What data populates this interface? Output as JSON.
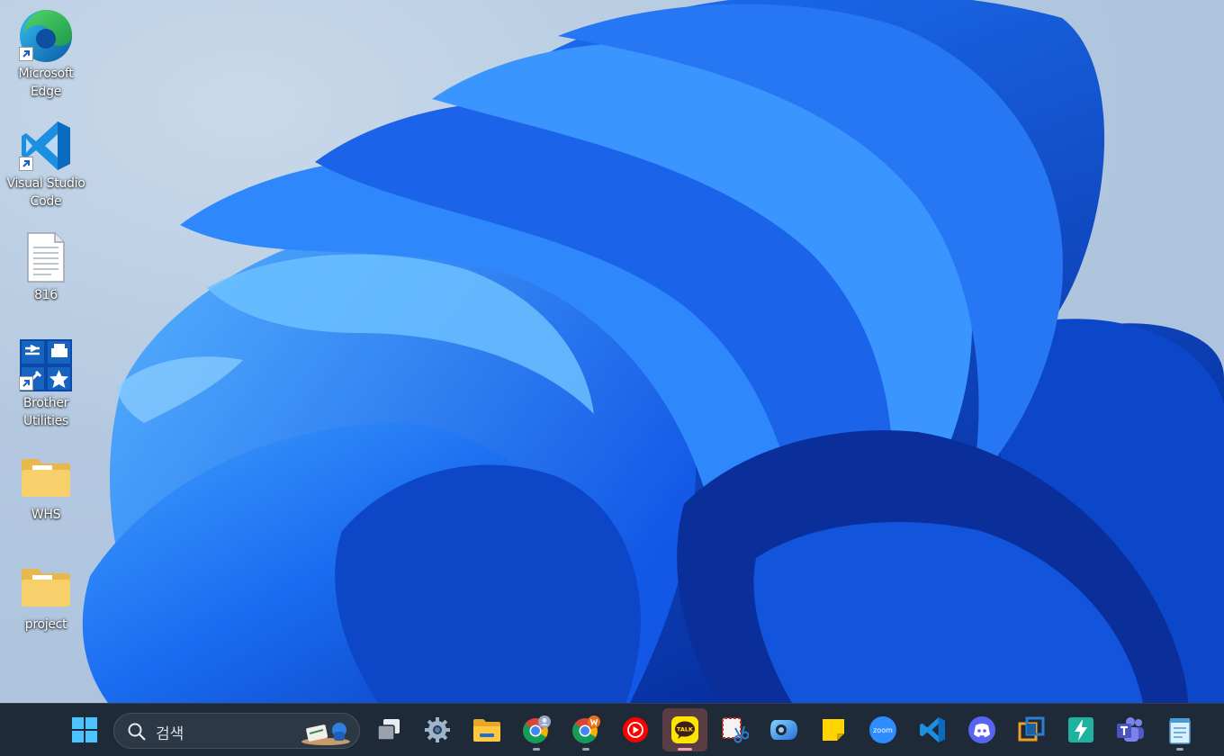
{
  "desktop": {
    "icons": [
      {
        "label": "Microsoft\nEdge",
        "icon": "edge-icon",
        "shortcut": true
      },
      {
        "label": "Visual Studio\nCode",
        "icon": "vscode-icon",
        "shortcut": true
      },
      {
        "label": "816",
        "icon": "text-file-icon",
        "shortcut": false
      },
      {
        "label": "Brother\nUtilities",
        "icon": "brother-utilities-icon",
        "shortcut": true
      },
      {
        "label": "WHS",
        "icon": "folder-icon",
        "shortcut": false
      },
      {
        "label": "project",
        "icon": "folder-icon",
        "shortcut": false
      }
    ]
  },
  "taskbar": {
    "search_placeholder": "검색",
    "kakao_label": "TALK",
    "zoom_label": "zoom",
    "apps": [
      {
        "name": "start-button",
        "icon": "windows-logo-icon"
      },
      {
        "name": "task-view-button",
        "icon": "task-view-icon"
      },
      {
        "name": "settings-app",
        "icon": "gear-icon"
      },
      {
        "name": "file-explorer-app",
        "icon": "folder-icon",
        "running": false
      },
      {
        "name": "chrome-profile-1-app",
        "icon": "chrome-icon",
        "running": true
      },
      {
        "name": "chrome-profile-2-app",
        "icon": "chrome-icon",
        "running": true
      },
      {
        "name": "youtube-music-app",
        "icon": "youtube-music-icon"
      },
      {
        "name": "kakaotalk-app",
        "icon": "kakaotalk-icon",
        "running": true,
        "active": true
      },
      {
        "name": "snipping-tool-app",
        "icon": "snipping-tool-icon"
      },
      {
        "name": "copilot-app",
        "icon": "copilot-icon"
      },
      {
        "name": "sticky-notes-app",
        "icon": "sticky-notes-icon"
      },
      {
        "name": "zoom-app",
        "icon": "zoom-icon"
      },
      {
        "name": "vscode-app",
        "icon": "vscode-icon"
      },
      {
        "name": "discord-app",
        "icon": "discord-icon"
      },
      {
        "name": "virtualbox-app",
        "icon": "virtualbox-icon"
      },
      {
        "name": "power-automate-app",
        "icon": "bolt-icon"
      },
      {
        "name": "teams-app",
        "icon": "teams-icon"
      },
      {
        "name": "notepad-app",
        "icon": "notepad-icon",
        "running": true
      }
    ]
  },
  "colors": {
    "taskbar_bg": "#1f2a38",
    "wallpaper_bloom": "#1565f0",
    "active_app_bg": "#5a3d43"
  }
}
